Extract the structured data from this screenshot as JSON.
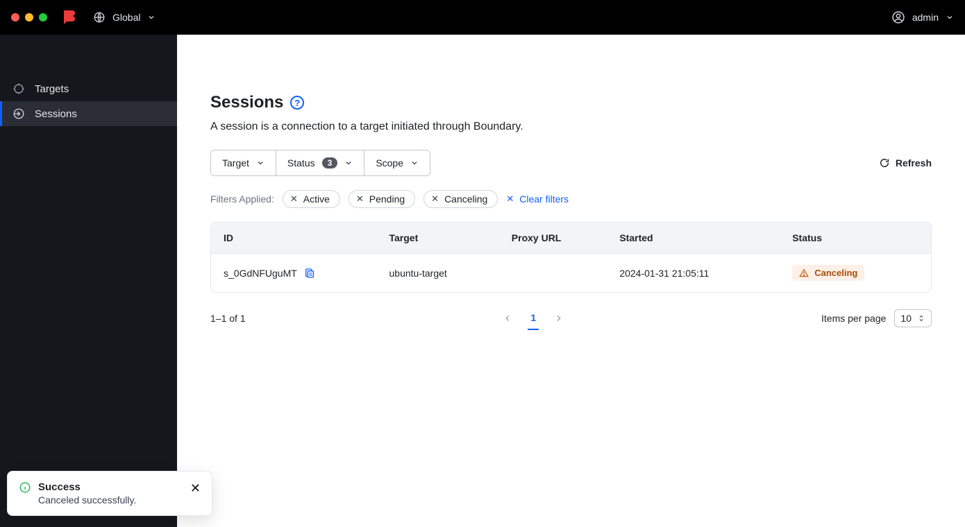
{
  "header": {
    "scope_label": "Global",
    "user_label": "admin"
  },
  "sidebar": {
    "items": [
      {
        "label": "Targets"
      },
      {
        "label": "Sessions"
      }
    ]
  },
  "page": {
    "title": "Sessions",
    "description": "A session is a connection to a target initiated through Boundary."
  },
  "filters": {
    "target_label": "Target",
    "status_label": "Status",
    "status_count": "3",
    "scope_label": "Scope",
    "refresh_label": "Refresh",
    "applied_label": "Filters Applied:",
    "chips": [
      {
        "label": "Active"
      },
      {
        "label": "Pending"
      },
      {
        "label": "Canceling"
      }
    ],
    "clear_label": "Clear filters"
  },
  "table": {
    "headers": {
      "id": "ID",
      "target": "Target",
      "proxy": "Proxy URL",
      "started": "Started",
      "status": "Status"
    },
    "rows": [
      {
        "id": "s_0GdNFUguMT",
        "target": "ubuntu-target",
        "proxy": "",
        "started": "2024-01-31 21:05:11",
        "status": "Canceling"
      }
    ]
  },
  "pagination": {
    "summary": "1–1 of 1",
    "current": "1",
    "ipp_label": "Items per page",
    "ipp_value": "10"
  },
  "toast": {
    "title": "Success",
    "message": "Canceled successfully."
  }
}
